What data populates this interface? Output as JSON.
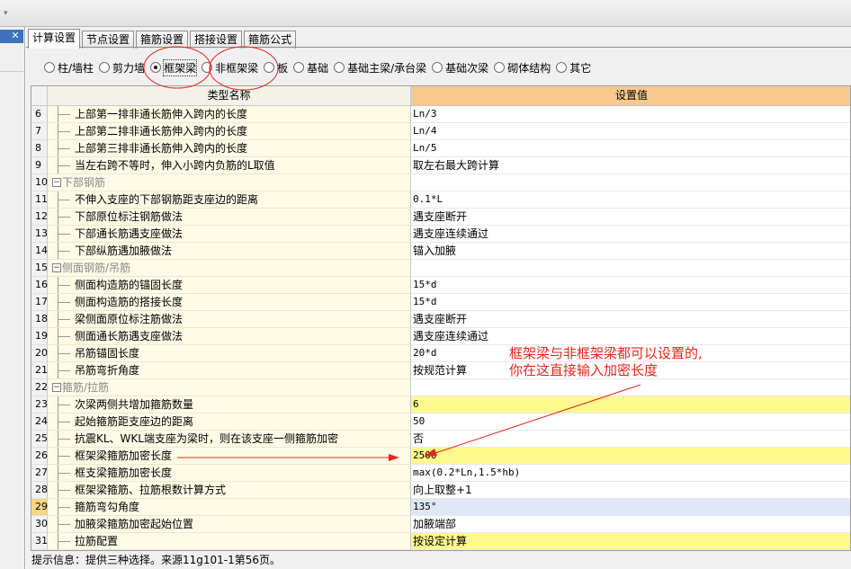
{
  "tabs": [
    {
      "label": "计算设置",
      "active": true
    },
    {
      "label": "节点设置",
      "active": false
    },
    {
      "label": "箍筋设置",
      "active": false
    },
    {
      "label": "搭接设置",
      "active": false
    },
    {
      "label": "箍筋公式",
      "active": false
    }
  ],
  "categories": [
    {
      "label": "柱/墙柱",
      "selected": false
    },
    {
      "label": "剪力墙",
      "selected": false
    },
    {
      "label": "框架梁",
      "selected": true
    },
    {
      "label": "非框架梁",
      "selected": false
    },
    {
      "label": "板",
      "selected": false
    },
    {
      "label": "基础",
      "selected": false
    },
    {
      "label": "基础主梁/承台梁",
      "selected": false
    },
    {
      "label": "基础次梁",
      "selected": false
    },
    {
      "label": "砌体结构",
      "selected": false
    },
    {
      "label": "其它",
      "selected": false
    }
  ],
  "table": {
    "col_name": "类型名称",
    "col_value": "设置值",
    "rows": [
      {
        "num": "6",
        "name": "上部第一排非通长筋伸入跨内的长度",
        "value": "Ln/3"
      },
      {
        "num": "7",
        "name": "上部第二排非通长筋伸入跨内的长度",
        "value": "Ln/4"
      },
      {
        "num": "8",
        "name": "上部第三排非通长筋伸入跨内的长度",
        "value": "Ln/5"
      },
      {
        "num": "9",
        "name": "当左右跨不等时，伸入小跨内负筋的L取值",
        "value": "取左右最大跨计算"
      },
      {
        "num": "10",
        "name": "下部钢筋",
        "value": "",
        "group": true
      },
      {
        "num": "11",
        "name": "不伸入支座的下部钢筋距支座边的距离",
        "value": "0.1*L"
      },
      {
        "num": "12",
        "name": "下部原位标注钢筋做法",
        "value": "遇支座断开"
      },
      {
        "num": "13",
        "name": "下部通长筋遇支座做法",
        "value": "遇支座连续通过"
      },
      {
        "num": "14",
        "name": "下部纵筋遇加腋做法",
        "value": "锚入加腋"
      },
      {
        "num": "15",
        "name": "侧面钢筋/吊筋",
        "value": "",
        "group": true
      },
      {
        "num": "16",
        "name": "侧面构造筋的锚固长度",
        "value": "15*d"
      },
      {
        "num": "17",
        "name": "侧面构造筋的搭接长度",
        "value": "15*d"
      },
      {
        "num": "18",
        "name": "梁侧面原位标注筋做法",
        "value": "遇支座断开"
      },
      {
        "num": "19",
        "name": "侧面通长筋遇支座做法",
        "value": "遇支座连续通过"
      },
      {
        "num": "20",
        "name": "吊筋锚固长度",
        "value": "20*d"
      },
      {
        "num": "21",
        "name": "吊筋弯折角度",
        "value": "按规范计算"
      },
      {
        "num": "22",
        "name": "箍筋/拉筋",
        "value": "",
        "group": true
      },
      {
        "num": "23",
        "name": "次梁两侧共增加箍筋数量",
        "value": "6",
        "bg": "yellow"
      },
      {
        "num": "24",
        "name": "起始箍筋距支座边的距离",
        "value": "50"
      },
      {
        "num": "25",
        "name": "抗震KL、WKL端支座为梁时，则在该支座一侧箍筋加密",
        "value": "否"
      },
      {
        "num": "26",
        "name": "框架梁箍筋加密长度",
        "value": "2500",
        "bg": "yellow"
      },
      {
        "num": "27",
        "name": "框支梁箍筋加密长度",
        "value": "max(0.2*Ln,1.5*hb)"
      },
      {
        "num": "28",
        "name": "框架梁箍筋、拉筋根数计算方式",
        "value": "向上取整+1"
      },
      {
        "num": "29",
        "name": "箍筋弯勾角度",
        "value": "135°",
        "bg": "blue",
        "highlight": true
      },
      {
        "num": "30",
        "name": "加腋梁箍筋加密起始位置",
        "value": "加腋端部"
      },
      {
        "num": "31",
        "name": "拉筋配置",
        "value": "按设定计算",
        "bg": "yellow"
      }
    ]
  },
  "status": "提示信息：提供三种选择。来源11g101-1第56页。",
  "annotation": {
    "lines": [
      "框架梁与非框架梁都可以设置的,",
      "你在这直接输入加密长度"
    ],
    "color": "#e8241b"
  },
  "icons": {
    "close": "close-icon",
    "toolbar_dropdown": "chevron-down-icon"
  }
}
